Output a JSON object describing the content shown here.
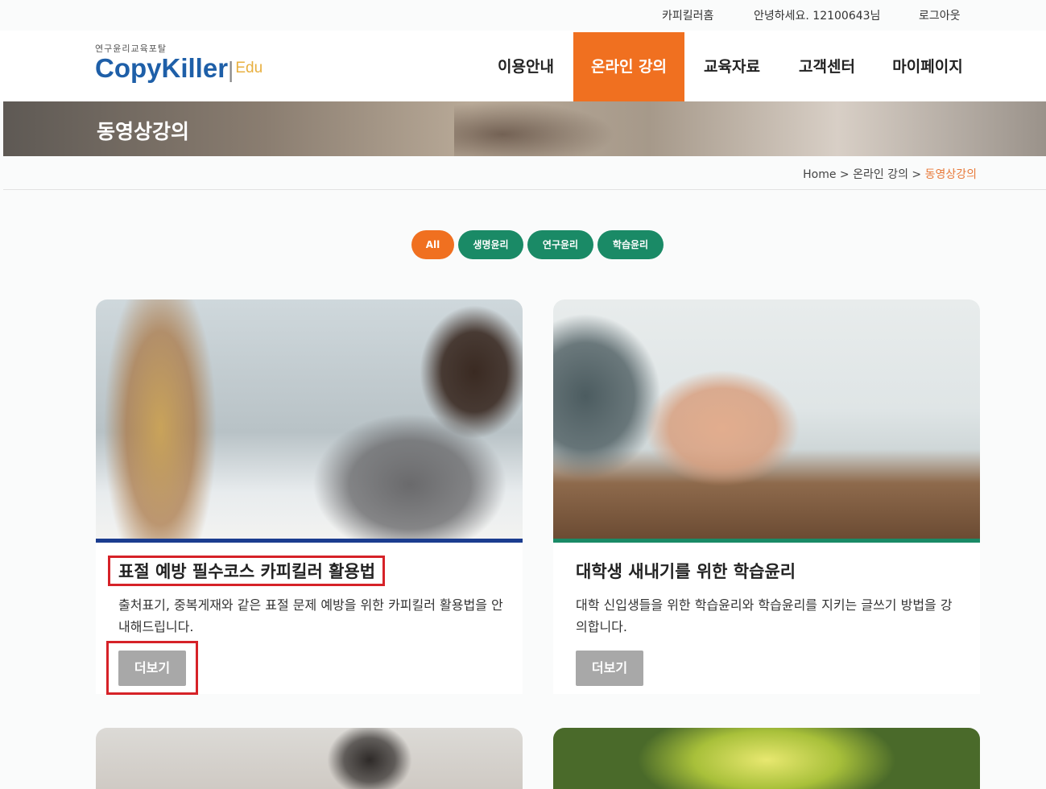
{
  "topbar": {
    "home_link": "카피킬러홈",
    "greeting": "안녕하세요. 12100643님",
    "logout": "로그아웃"
  },
  "logo": {
    "subtitle": "연구윤리교육포탈",
    "name": "CopyKiller",
    "suffix": "Edu"
  },
  "nav": {
    "items": [
      "이용안내",
      "온라인 강의",
      "교육자료",
      "고객센터",
      "마이페이지"
    ],
    "active": "온라인 강의"
  },
  "banner": {
    "title": "동영상강의"
  },
  "breadcrumb": {
    "home": "Home",
    "sep": ">",
    "level1": "온라인 강의",
    "current": "동영상강의"
  },
  "filters": [
    "All",
    "생명윤리",
    "연구윤리",
    "학습윤리"
  ],
  "cards": [
    {
      "title": "표절 예방 필수코스 카피킬러 활용법",
      "desc": "출처표기, 중복게재와 같은 표절 문제 예방을 위한 카피킬러 활용법을 안내해드립니다.",
      "button": "더보기"
    },
    {
      "title": "대학생 새내기를 위한 학습윤리",
      "desc": "대학 신입생들을 위한 학습윤리와 학습윤리를 지키는 글쓰기 방법을 강의합니다.",
      "button": "더보기"
    }
  ],
  "colors": {
    "accent_orange": "#f07020",
    "green": "#1a8a66",
    "logo_blue": "#1e5fa8",
    "highlight_red": "#d62228"
  }
}
